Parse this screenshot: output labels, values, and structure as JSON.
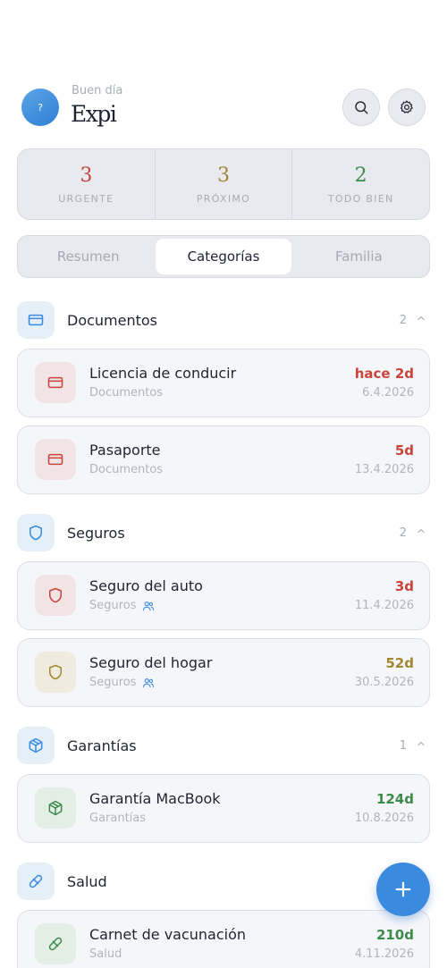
{
  "header": {
    "avatar_text": "?",
    "greeting": "Buen día",
    "title": "Expi"
  },
  "stats": [
    {
      "value": "3",
      "label": "URGENTE",
      "color": "#c8453c"
    },
    {
      "value": "3",
      "label": "PRÓXIMO",
      "color": "#a3872f"
    },
    {
      "value": "2",
      "label": "TODO BIEN",
      "color": "#3c8b4a"
    }
  ],
  "tabs": [
    {
      "label": "Resumen"
    },
    {
      "label": "Categorías",
      "active": true
    },
    {
      "label": "Familia"
    }
  ],
  "categories": [
    {
      "name": "Documentos",
      "count": "2",
      "icon": "card-icon",
      "items": [
        {
          "title": "Licencia de conducir",
          "category": "Documentos",
          "days": "hace 2d",
          "date": "6.4.2026",
          "status": "urgent",
          "shared": false,
          "icon": "card-icon"
        },
        {
          "title": "Pasaporte",
          "category": "Documentos",
          "days": "5d",
          "date": "13.4.2026",
          "status": "urgent",
          "shared": false,
          "icon": "card-icon"
        }
      ]
    },
    {
      "name": "Seguros",
      "count": "2",
      "icon": "shield-icon",
      "items": [
        {
          "title": "Seguro del auto",
          "category": "Seguros",
          "days": "3d",
          "date": "11.4.2026",
          "status": "urgent",
          "shared": true,
          "icon": "shield-icon"
        },
        {
          "title": "Seguro del hogar",
          "category": "Seguros",
          "days": "52d",
          "date": "30.5.2026",
          "status": "soon",
          "shared": true,
          "icon": "shield-icon"
        }
      ]
    },
    {
      "name": "Garantías",
      "count": "1",
      "icon": "box-icon",
      "items": [
        {
          "title": "Garantía MacBook",
          "category": "Garantías",
          "days": "124d",
          "date": "10.8.2026",
          "status": "ok",
          "shared": false,
          "icon": "box-icon"
        }
      ]
    },
    {
      "name": "Salud",
      "count": "",
      "icon": "pill-icon",
      "items": [
        {
          "title": "Carnet de vacunación",
          "category": "Salud",
          "days": "210d",
          "date": "4.11.2026",
          "status": "ok",
          "shared": false,
          "icon": "pill-icon"
        }
      ]
    }
  ],
  "colors": {
    "urgent": "#c8453c",
    "urgent_bg": "#f2e3e4",
    "soon": "#a3872f",
    "soon_bg": "#efebdf",
    "ok": "#3c8b4a",
    "ok_bg": "#e3eee5",
    "accent": "#3a8be0"
  }
}
